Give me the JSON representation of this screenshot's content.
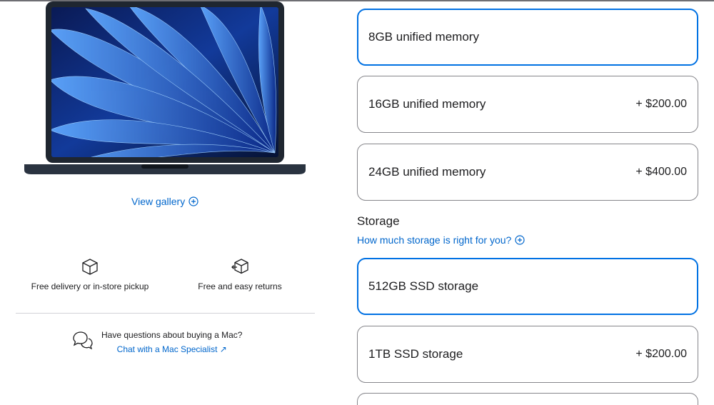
{
  "gallery": {
    "label": "View gallery"
  },
  "perks": [
    {
      "label": "Free delivery or in-store pickup",
      "icon": "box-icon"
    },
    {
      "label": "Free and easy returns",
      "icon": "return-box-icon"
    }
  ],
  "help": {
    "question": "Have questions about buying a Mac?",
    "link": "Chat with a Mac Specialist ↗"
  },
  "memory": {
    "options": [
      {
        "name": "8GB unified memory",
        "price": "",
        "selected": true
      },
      {
        "name": "16GB unified memory",
        "price": "+ $200.00",
        "selected": false
      },
      {
        "name": "24GB unified memory",
        "price": "+ $400.00",
        "selected": false
      }
    ]
  },
  "storage": {
    "title": "Storage",
    "help_link": "How much storage is right for you?",
    "options": [
      {
        "name": "512GB SSD storage",
        "price": "",
        "selected": true
      },
      {
        "name": "1TB SSD storage",
        "price": "+ $200.00",
        "selected": false
      }
    ]
  },
  "colors": {
    "accent": "#0071e3",
    "link": "#0066cc",
    "border": "#86868b"
  }
}
